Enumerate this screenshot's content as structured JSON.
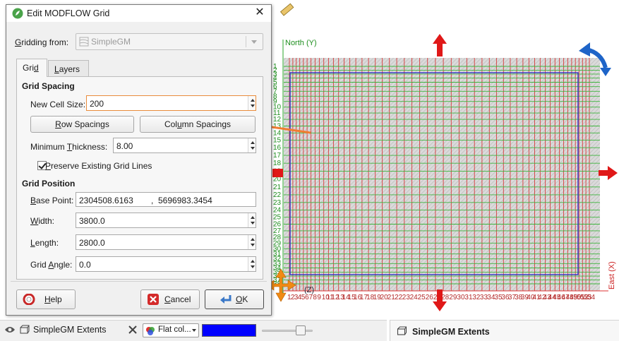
{
  "dialog": {
    "title": "Edit MODFLOW Grid",
    "gridding_from_label": "Gridding from:",
    "gridding_from_value": "SimpleGM",
    "tabs": [
      "Grid",
      "Layers"
    ],
    "active_tab": "Grid",
    "grid_spacing_heading": "Grid Spacing",
    "new_cell_size_label": "New Cell Size:",
    "new_cell_size_value": "200",
    "row_spacings_button": "Row Spacings",
    "column_spacings_button": "Column Spacings",
    "min_thickness_label": "Minimum Thickness:",
    "min_thickness_value": "8.00",
    "preserve_label": "Preserve Existing Grid Lines",
    "preserve_checked": true,
    "grid_position_heading": "Grid Position",
    "base_point_label": "Base Point:",
    "base_point_x": "2304508.6163",
    "base_point_sep": ",",
    "base_point_y": "5696983.3454",
    "width_label": "Width:",
    "width_value": "3800.0",
    "length_label": "Length:",
    "length_value": "2800.0",
    "grid_angle_label": "Grid Angle:",
    "grid_angle_value": "0.0",
    "help_button": "Help",
    "cancel_button": "Cancel",
    "ok_button": "OK",
    "close_icon": "close-icon"
  },
  "viewer": {
    "north_axis_label": "North (Y)",
    "east_axis_label": "East (X)",
    "z_axis_label": "(Z)",
    "row_labels": [
      "1",
      "2",
      "3",
      "4",
      "5",
      "6",
      "7",
      "8",
      "9",
      "10",
      "11",
      "12",
      "13",
      "14",
      "15",
      "16",
      "17",
      "18",
      "19",
      "20",
      "21",
      "22",
      "23",
      "24",
      "25",
      "26",
      "27",
      "28",
      "29",
      "30",
      "31",
      "32",
      "33",
      "34",
      "35",
      "36",
      "37",
      "38"
    ],
    "column_labels": [
      "1",
      "2",
      "3",
      "4",
      "5",
      "6",
      "7",
      "8",
      "9",
      "10",
      "11",
      "12",
      "13",
      "14",
      "15",
      "16",
      "17",
      "18",
      "19",
      "20",
      "21",
      "22",
      "23",
      "24",
      "25",
      "26",
      "27",
      "28",
      "29",
      "30",
      "31",
      "32",
      "33",
      "34",
      "35",
      "36",
      "37",
      "38",
      "39",
      "40",
      "41",
      "42",
      "43",
      "44",
      "45",
      "46",
      "47",
      "48",
      "49",
      "50",
      "51",
      "52",
      "53",
      "54"
    ],
    "colors": {
      "column_lines": "#d93a3a",
      "row_lines": "#3cb43c",
      "model_boundary": "#2828c8",
      "handle_arrow": "#e01818",
      "rotate_handle": "#1e64c8",
      "move_handle": "#f08a14",
      "annotation_arrow": "#f07c30"
    }
  },
  "scene_list": {
    "object_name": "SimpleGM Extents",
    "colour_mode": "Flat col...",
    "colour": "#0000ff",
    "opacity": 0.75
  },
  "properties_panel": {
    "title": "SimpleGM Extents"
  }
}
